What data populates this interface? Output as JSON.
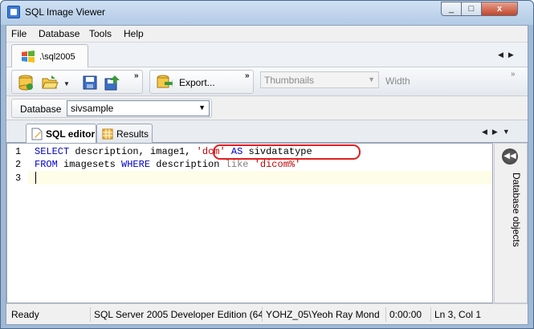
{
  "window": {
    "title": "SQL Image Viewer",
    "minimize": "_",
    "maximize": "□",
    "close": "x"
  },
  "menu": {
    "items": [
      "File",
      "Database",
      "Tools",
      "Help"
    ]
  },
  "server_tab": {
    "label": ".\\sql2005",
    "icon": "windows-server-icon"
  },
  "toolbar": {
    "export_label": "Export...",
    "view_mode": "Thumbnails",
    "width_label": "Width",
    "icons": [
      "database-add-icon",
      "folder-open-icon",
      "save-icon",
      "save-all-icon",
      "export-icon"
    ]
  },
  "database": {
    "label": "Database",
    "selected": "sivsample"
  },
  "editor_tabs": [
    {
      "label": "SQL editor",
      "icon": "sql-editor-icon"
    },
    {
      "label": "Results",
      "icon": "grid-icon"
    }
  ],
  "editor": {
    "line_numbers": [
      "1",
      "2",
      "3"
    ],
    "line1": {
      "kw1": "SELECT",
      "t1": " description, image1, ",
      "s1": "'dcm'",
      "t2": " ",
      "kw2": "AS",
      "t3": " sivdatatype"
    },
    "line2": {
      "kw1": "FROM",
      "t1": " imagesets ",
      "kw2": "WHERE",
      "t2": " description ",
      "op": "like",
      "t3": " ",
      "s1": "'dicom%'"
    },
    "line3": ""
  },
  "side_panel": {
    "label": "Database objects",
    "icon": "collapse-left-icon"
  },
  "status": {
    "state": "Ready",
    "server": "SQL Server 2005 Developer Edition (64-l",
    "user": "YOHZ_05\\Yeoh Ray Mond",
    "elapsed": "0:00:00",
    "position": "Ln 3, Col 1"
  }
}
